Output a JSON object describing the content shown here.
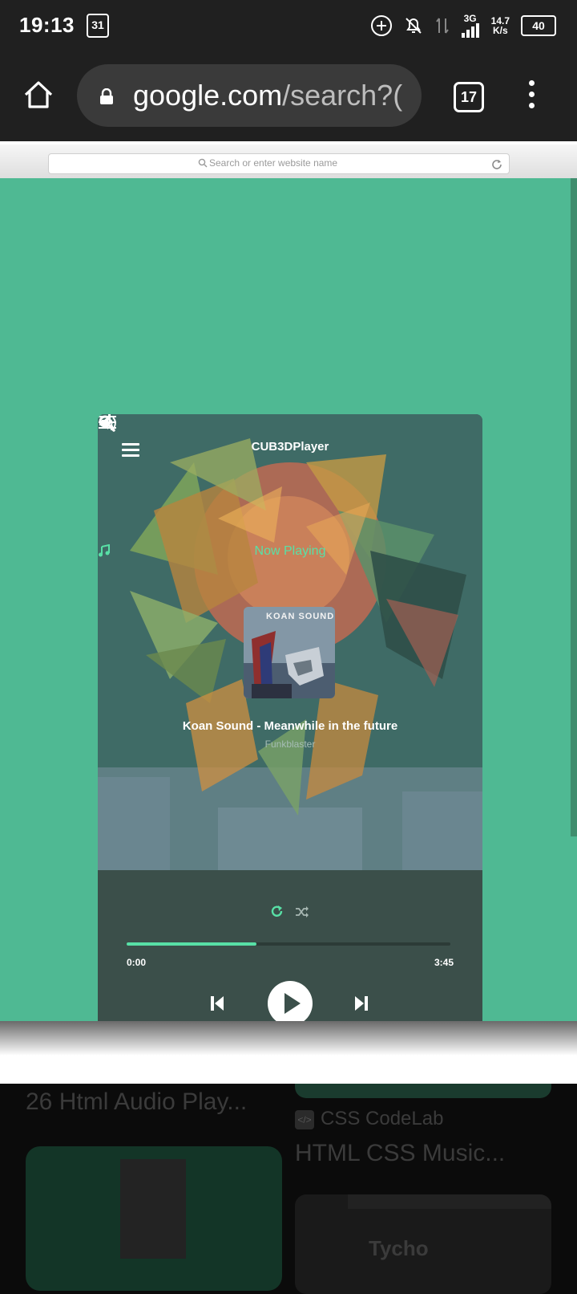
{
  "status": {
    "time": "19:13",
    "calendar_day": "31",
    "network": "3G",
    "speed": "14.7",
    "speed_unit": "K/s",
    "battery": "40"
  },
  "browser": {
    "url_domain": "google.com",
    "url_path": "/search?(",
    "tab_count": "17"
  },
  "page": {
    "address_placeholder": "Search or enter website name"
  },
  "player": {
    "app_title": "CUB3DPlayer",
    "now_playing": "Now Playing",
    "track_title": "Koan Sound - Meanwhile in the future",
    "artist": "Funkblaster",
    "time_current": "0:00",
    "time_total": "3:45",
    "progress": 0.4,
    "accent": "#58e0a6",
    "cover_logo": "KOAN SOUND"
  },
  "results": {
    "title_left": "26 Html Audio Play...",
    "source_right": "CSS CodeLab",
    "title_right": "HTML CSS Music...",
    "thumb_text": "Tycho"
  }
}
